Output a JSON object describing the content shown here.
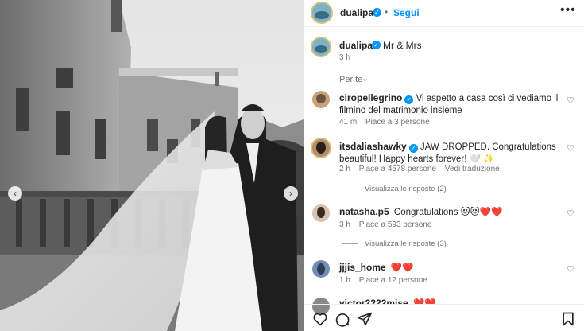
{
  "header": {
    "username": "dualipa",
    "follow_label": "Segui",
    "more_label": "•••"
  },
  "caption": {
    "username": "dualipa",
    "text": "Mr & Mrs",
    "time": "3 h"
  },
  "translation_hint": "Per te",
  "comments": [
    {
      "username": "ciropellegrino",
      "verified": true,
      "text": "Vi aspetto a casa così ci vediamo il filmino del matrimonio insieme",
      "time": "41 m",
      "likes": "Piace a 3 persone"
    },
    {
      "username": "itsdaliashawky",
      "verified": true,
      "text": "JAW DROPPED. Congratulations beautiful! Happy hearts forever! 🤍 ✨",
      "time": "2 h",
      "likes": "Piace a 4578 persone",
      "translate": "Vedi traduzione",
      "replies": "Visualizza le risposte (2)"
    },
    {
      "username": "natasha.p5",
      "verified": false,
      "text": "Congratulations 😻😻❤️❤️",
      "time": "3 h",
      "likes": "Piace a 593 persone",
      "replies": "Visualizza le risposte (3)"
    },
    {
      "username": "jjjis_home",
      "verified": false,
      "text": "❤️❤️",
      "time": "1 h",
      "likes": "Piace a 12 persone"
    },
    {
      "username": "victor2222mise",
      "verified": false,
      "text": "❤️❤️",
      "time": "",
      "likes": ""
    }
  ],
  "icons": {
    "like": "heart-icon",
    "comment": "comment-icon",
    "share": "share-icon",
    "save": "bookmark-icon"
  },
  "colors": {
    "accent": "#0095f6",
    "text": "#262626",
    "muted": "#737373"
  }
}
